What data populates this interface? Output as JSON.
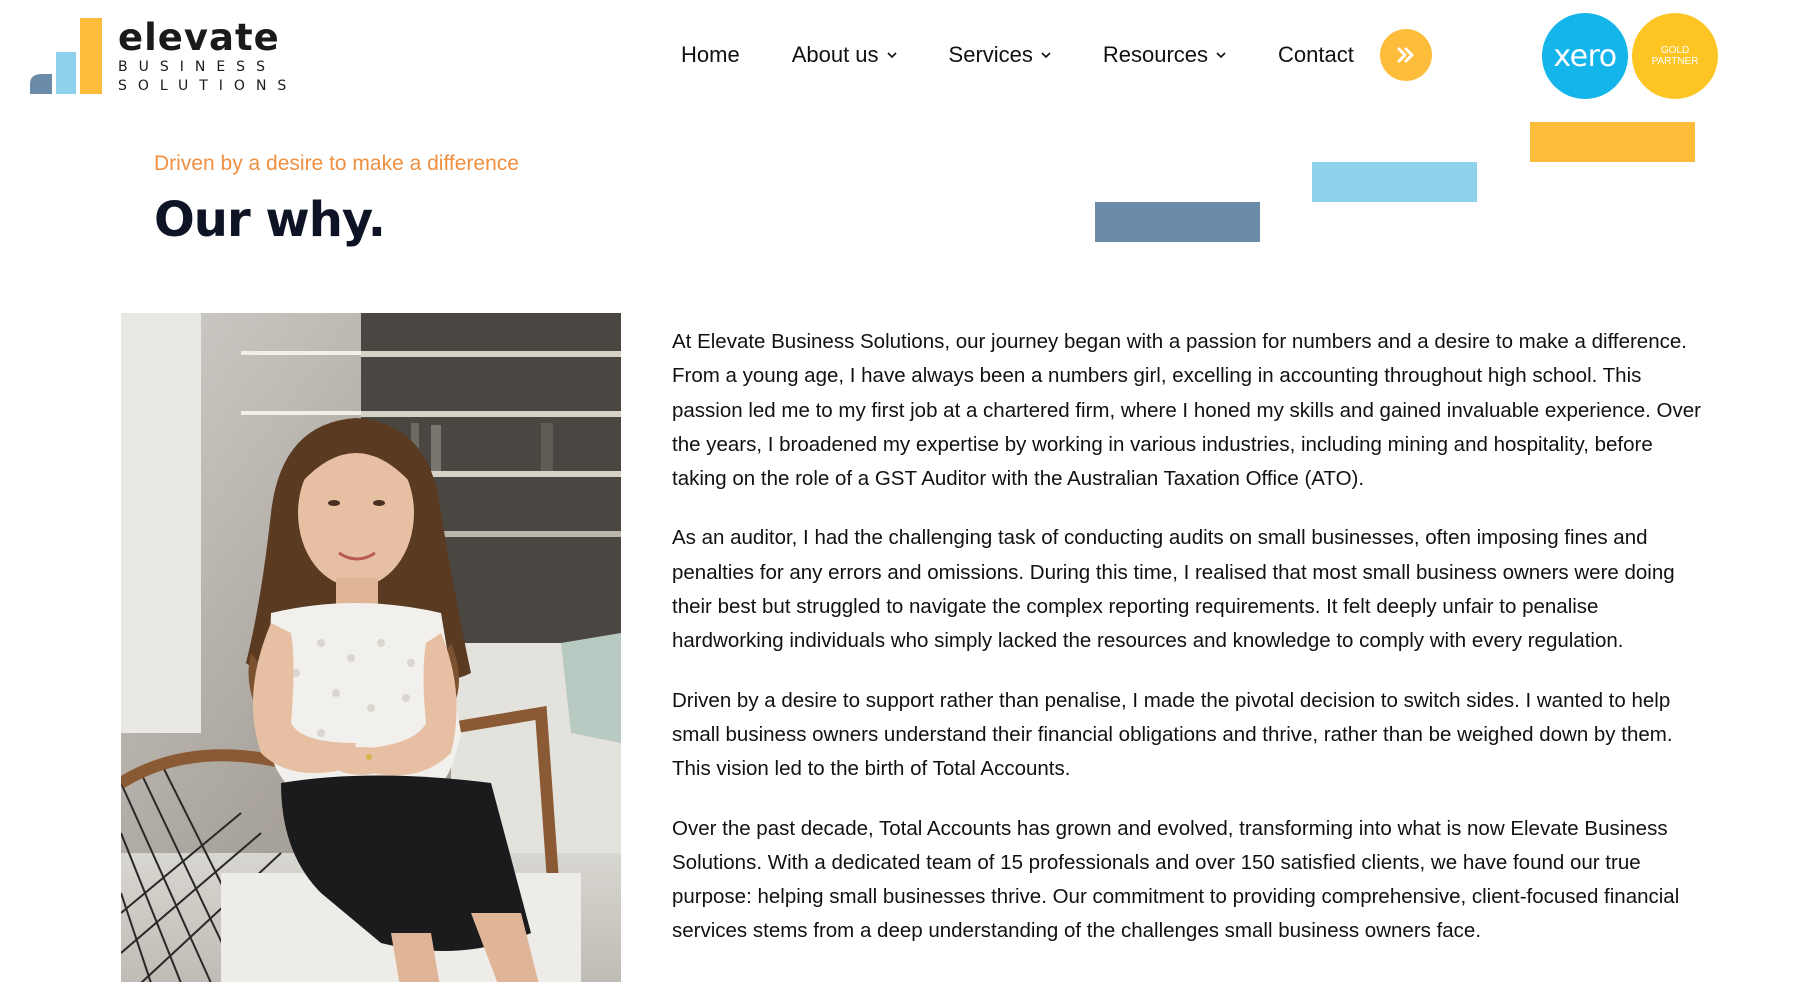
{
  "brand": {
    "name": "elevate",
    "subtitle_line1": "BUSINESS",
    "subtitle_line2": "SOLUTIONS",
    "colors": {
      "steel": "#6a8ca8",
      "light_blue": "#8fd0ec",
      "yellow": "#fdbd3a"
    }
  },
  "nav": {
    "items": [
      {
        "label": "Home",
        "has_dropdown": false
      },
      {
        "label": "About us",
        "has_dropdown": true
      },
      {
        "label": "Services",
        "has_dropdown": true
      },
      {
        "label": "Resources",
        "has_dropdown": true
      },
      {
        "label": "Contact",
        "has_dropdown": false
      }
    ],
    "cta_icon": "double-chevron-right-icon"
  },
  "partner": {
    "xero_label": "xero",
    "gold_line1": "GOLD",
    "gold_line2": "PARTNER"
  },
  "section": {
    "eyebrow": "Driven by a desire to make a difference",
    "title": "Our why.",
    "paragraphs": [
      "At Elevate Business Solutions, our journey began with a passion for numbers and a desire to make a difference. From a young age, I have always been a numbers girl, excelling in accounting throughout high school. This passion led me to my first job at a chartered firm, where I honed my skills and gained invaluable experience. Over the years, I broadened my expertise by working in various industries, including mining and hospitality, before taking on the role of a GST Auditor with the Australian Taxation Office (ATO).",
      "As an auditor, I had the challenging task of conducting audits on small businesses, often imposing fines and penalties for any errors and omissions. During this time, I realised that most small business owners were doing their best but struggled to navigate the complex reporting requirements. It felt deeply unfair to penalise hardworking individuals who simply lacked the resources and knowledge to comply with every regulation.",
      "Driven by a desire to support rather than penalise, I made the pivotal decision to switch sides. I wanted to help small business owners understand their financial obligations and thrive, rather than be weighed down by them. This vision led to the birth of Total Accounts.",
      "Over the past decade, Total Accounts has grown and evolved, transforming into what is now Elevate Business Solutions. With a dedicated team of 15 professionals and over 150 satisfied clients, we have found our true purpose: helping small businesses thrive. Our commitment to providing comprehensive, client-focused financial services stems from a deep understanding of the challenges small business owners face."
    ]
  }
}
